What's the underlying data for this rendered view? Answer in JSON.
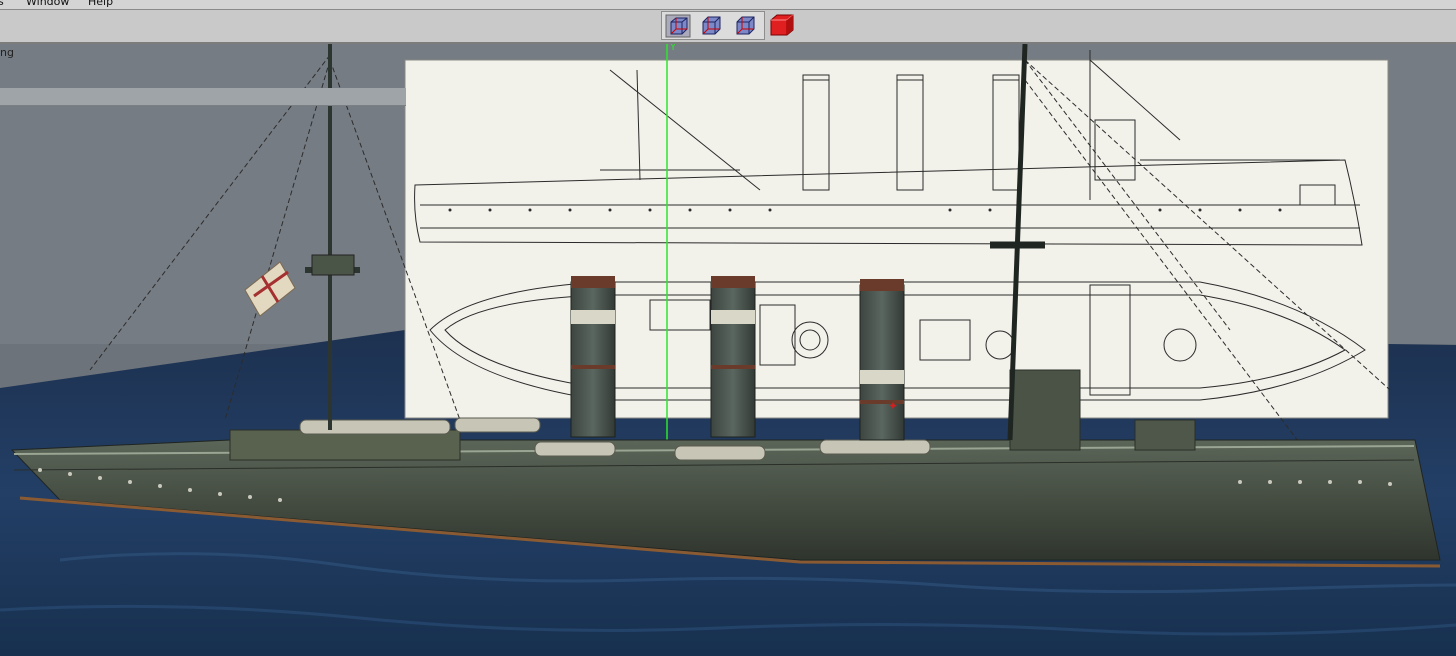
{
  "menubar": {
    "items": [
      {
        "label": "s"
      },
      {
        "label": "Window"
      },
      {
        "label": "Help"
      }
    ]
  },
  "toolbar": {
    "view_buttons": [
      {
        "icon": "wire-cube-front-icon"
      },
      {
        "icon": "wire-cube-top-icon"
      },
      {
        "icon": "wire-cube-side-icon"
      },
      {
        "icon": "solid-red-cube-icon"
      }
    ]
  },
  "viewport": {
    "label": "ng",
    "axis_label": "Y",
    "colors": {
      "sky": "#6d737a",
      "sea": "#1e3554",
      "hull": "#4b5448",
      "blueprint": "#f2f1ea",
      "axis": "#2ee52e"
    }
  }
}
